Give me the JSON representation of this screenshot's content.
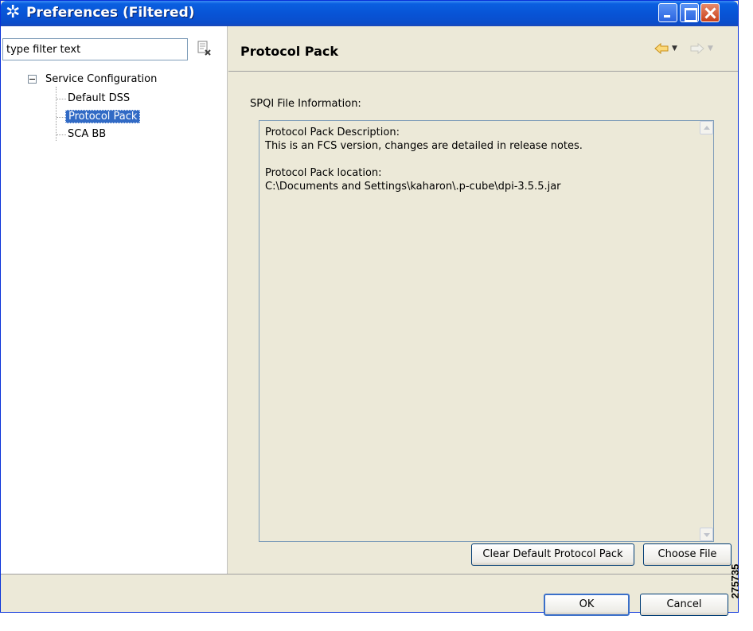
{
  "window": {
    "title": "Preferences (Filtered)",
    "icons": {
      "logo": "preferences-logo-icon",
      "minimize": "minimize-icon",
      "maximize": "maximize-icon",
      "close": "close-icon"
    }
  },
  "filter": {
    "placeholder": "type filter text",
    "value": "type filter text",
    "clear_icon": "clear-filter-icon"
  },
  "tree": {
    "root": {
      "label": "Service Configuration",
      "expanded": true
    },
    "children": [
      {
        "label": "Default DSS",
        "selected": false
      },
      {
        "label": "Protocol Pack",
        "selected": true
      },
      {
        "label": "SCA BB",
        "selected": false
      }
    ]
  },
  "page": {
    "title": "Protocol Pack",
    "nav": {
      "back_icon": "back-arrow-icon",
      "forward_icon": "forward-arrow-icon",
      "dropdown_icon": "dropdown-arrow-icon"
    },
    "section_label": "SPQI File Information:",
    "info_lines": "Protocol Pack Description:\nThis is an FCS version, changes are detailed in release notes.\n\nProtocol Pack location:\nC:\\Documents and Settings\\kaharon\\.p-cube\\dpi-3.5.5.jar",
    "buttons": {
      "clear_default": "Clear Default Protocol Pack",
      "choose_file": "Choose File"
    }
  },
  "footer": {
    "ok": "OK",
    "cancel": "Cancel"
  },
  "figure_number": "275735",
  "colors": {
    "titlebar": "#0a5fe0",
    "selection": "#316ac5",
    "back_arrow": "#f2b33d"
  }
}
